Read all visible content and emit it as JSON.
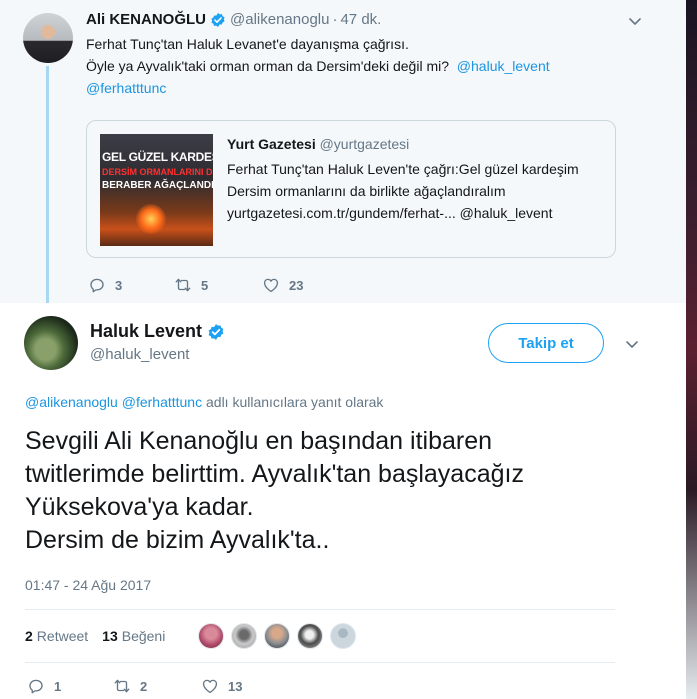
{
  "parent_tweet": {
    "author_name": "Ali KENANOĞLU",
    "author_handle": "@alikenanoglu",
    "time": "47 dk.",
    "separator": "·",
    "text_line1": "Ferhat Tunç'tan Haluk Levanet'e dayanışma çağrısı.",
    "text_line2": "Öyle ya Ayvalık'taki orman orman da Dersim'deki değil mi?",
    "mention1": "@haluk_levent",
    "mention2": "@ferhatttunc",
    "card": {
      "image_text_line1": "GEL GÜZEL KARDEŞİM",
      "image_text_line2": "DERSİM ORMANLARINI DA",
      "image_text_line3": "BERABER AĞAÇLANDIRALIM",
      "source_name": "Yurt Gazetesi",
      "source_handle": "@yurtgazetesi",
      "text_line1": "Ferhat Tunç'tan Haluk Leven'te çağrı:Gel güzel kardeşim",
      "text_line2": "Dersim ormanlarını da birlikte ağaçlandıralım",
      "text_line3": "yurtgazetesi.com.tr/gundem/ferhat-... @haluk_levent"
    },
    "actions": {
      "replies": "3",
      "retweets": "5",
      "likes": "23"
    }
  },
  "main_tweet": {
    "author_name": "Haluk Levent",
    "author_handle": "@haluk_levent",
    "follow_label": "Takip et",
    "reply_to1": "@alikenanoglu",
    "reply_to2": "@ferhatttunc",
    "reply_suffix": "adlı kullanıcılara yanıt olarak",
    "text": "Sevgili Ali Kenanoğlu en başından itibaren\ntwitlerimde belirttim. Ayvalık'tan başlayacağız\nYüksekova'ya kadar.\nDersim de bizim Ayvalık'ta..",
    "timestamp": "01:47 - 24 Ağu 2017",
    "retweet_count": "2",
    "retweet_label": "Retweet",
    "like_count": "13",
    "like_label": "Beğeni",
    "actions": {
      "replies": "1",
      "retweets": "2",
      "likes": "13"
    }
  },
  "colors": {
    "accent": "#1da1f2",
    "link": "#1b95e0",
    "muted": "#657786",
    "thread_line": "#a8d6f5",
    "parent_bg": "#f5f8fa"
  },
  "icons": [
    "verified-badge-icon",
    "chevron-down-icon",
    "reply-icon",
    "retweet-icon",
    "heart-icon"
  ]
}
